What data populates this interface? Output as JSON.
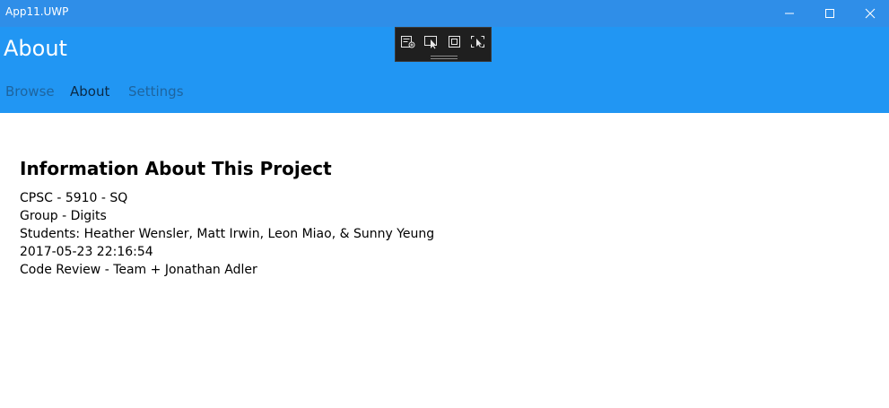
{
  "window": {
    "title": "App11.UWP",
    "controls": {
      "minimize_icon": "minimize-icon",
      "maximize_icon": "maximize-icon",
      "close_icon": "close-icon"
    }
  },
  "header": {
    "page_title": "About",
    "tabs": [
      {
        "label": "Browse",
        "active": false
      },
      {
        "label": "About",
        "active": true
      },
      {
        "label": "Settings",
        "active": false
      }
    ]
  },
  "debug_toolbar": {
    "buttons": [
      "live-visual-tree-icon",
      "select-element-icon",
      "display-layout-adorners-icon",
      "track-focused-element-icon"
    ]
  },
  "content": {
    "heading": "Information About This Project",
    "lines": [
      "CPSC - 5910 - SQ",
      "Group - Digits",
      "Students: Heather Wensler, Matt Irwin, Leon Miao, & Sunny Yeung",
      "2017-05-23 22:16:54",
      "Code Review - Team + Jonathan Adler"
    ]
  },
  "colors": {
    "titlebar": "#2f8ee8",
    "header": "#2196f3",
    "toolbar": "#1f1f1f"
  }
}
